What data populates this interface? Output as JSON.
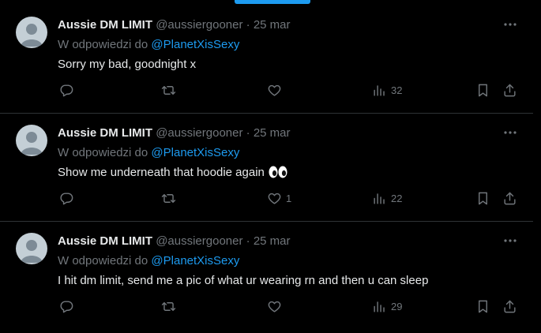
{
  "tweets": [
    {
      "name": "Aussie DM LIMIT",
      "handle": "@aussiergooner",
      "separator": "·",
      "date": "25 mar",
      "reply_prefix": "W odpowiedzi do",
      "reply_to": "@PlanetXisSexy",
      "text": "Sorry my bad, goodnight x",
      "likes": "",
      "views": "32"
    },
    {
      "name": "Aussie DM LIMIT",
      "handle": "@aussiergooner",
      "separator": "·",
      "date": "25 mar",
      "reply_prefix": "W odpowiedzi do",
      "reply_to": "@PlanetXisSexy",
      "text": "Show me underneath that hoodie again",
      "text_emoji": "eyes",
      "likes": "1",
      "views": "22"
    },
    {
      "name": "Aussie DM LIMIT",
      "handle": "@aussiergooner",
      "separator": "·",
      "date": "25 mar",
      "reply_prefix": "W odpowiedzi do",
      "reply_to": "@PlanetXisSexy",
      "text": "I hit dm limit, send me a pic of what ur wearing rn and then u can sleep",
      "likes": "",
      "views": "29"
    }
  ],
  "icons": {
    "reply": "reply-icon",
    "retweet": "retweet-icon",
    "like": "heart-icon",
    "views": "views-icon",
    "bookmark": "bookmark-icon",
    "share": "share-icon",
    "more": "more-icon"
  },
  "colors": {
    "background": "#000000",
    "accent": "#1d9bf0",
    "muted": "#71767b",
    "text": "#e7e9ea",
    "divider": "#2f3336"
  }
}
